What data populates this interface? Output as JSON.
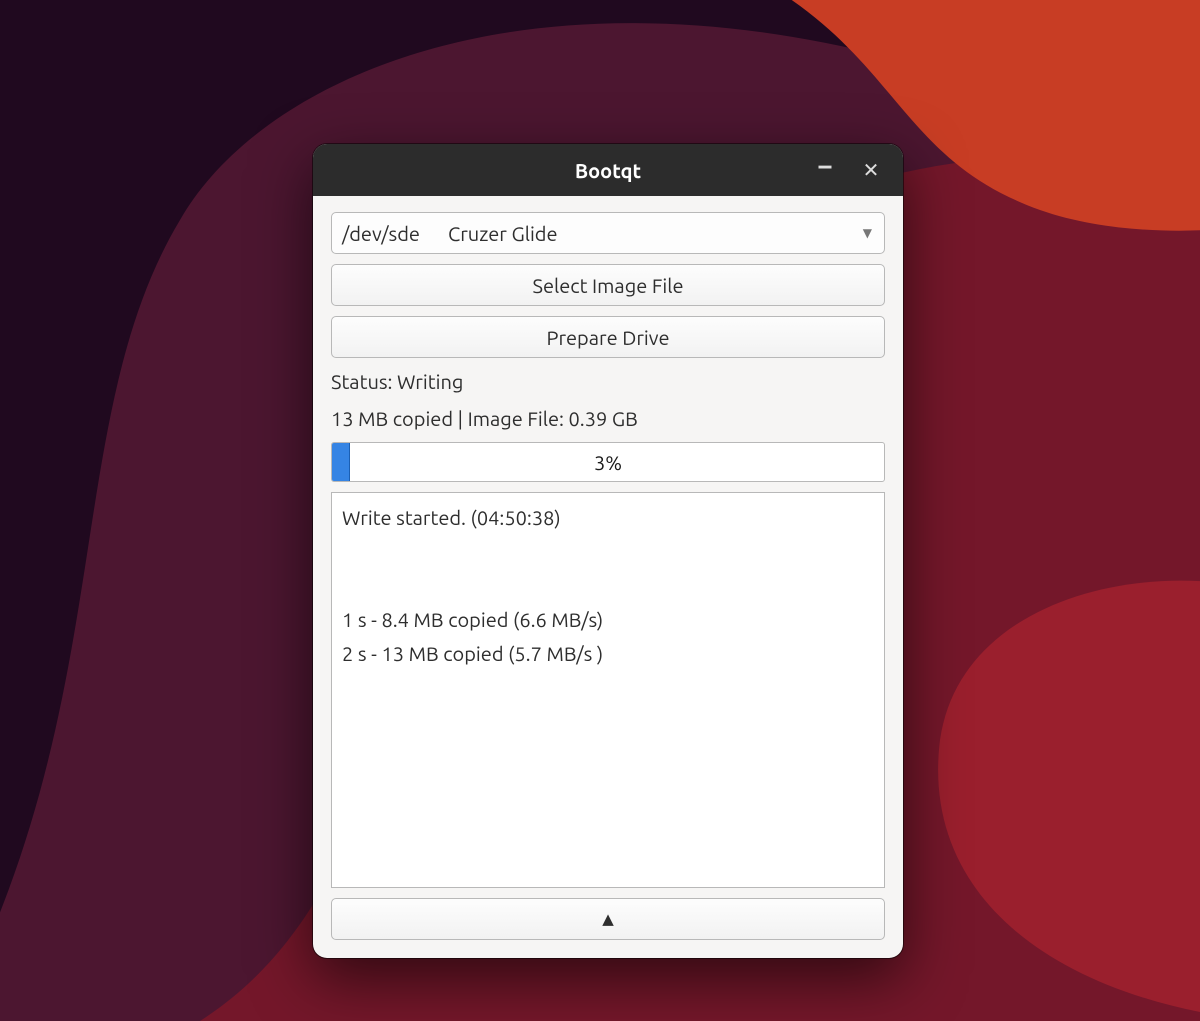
{
  "window": {
    "title": "Bootqt"
  },
  "drive_select": {
    "device": "/dev/sde",
    "label": "Cruzer Glide"
  },
  "buttons": {
    "select_image": "Select Image File",
    "prepare_drive": "Prepare Drive"
  },
  "status": {
    "line": "Status: Writing",
    "detail": "13 MB copied | Image File: 0.39 GB"
  },
  "progress": {
    "percent": 3,
    "label": "3%"
  },
  "log": {
    "lines": [
      "Write started. (04:50:38)",
      "",
      "",
      "1 s - 8.4 MB copied (6.6 MB/s)",
      "2 s - 13 MB copied (5.7 MB/s )"
    ]
  },
  "collapse": {
    "glyph": "▲"
  }
}
